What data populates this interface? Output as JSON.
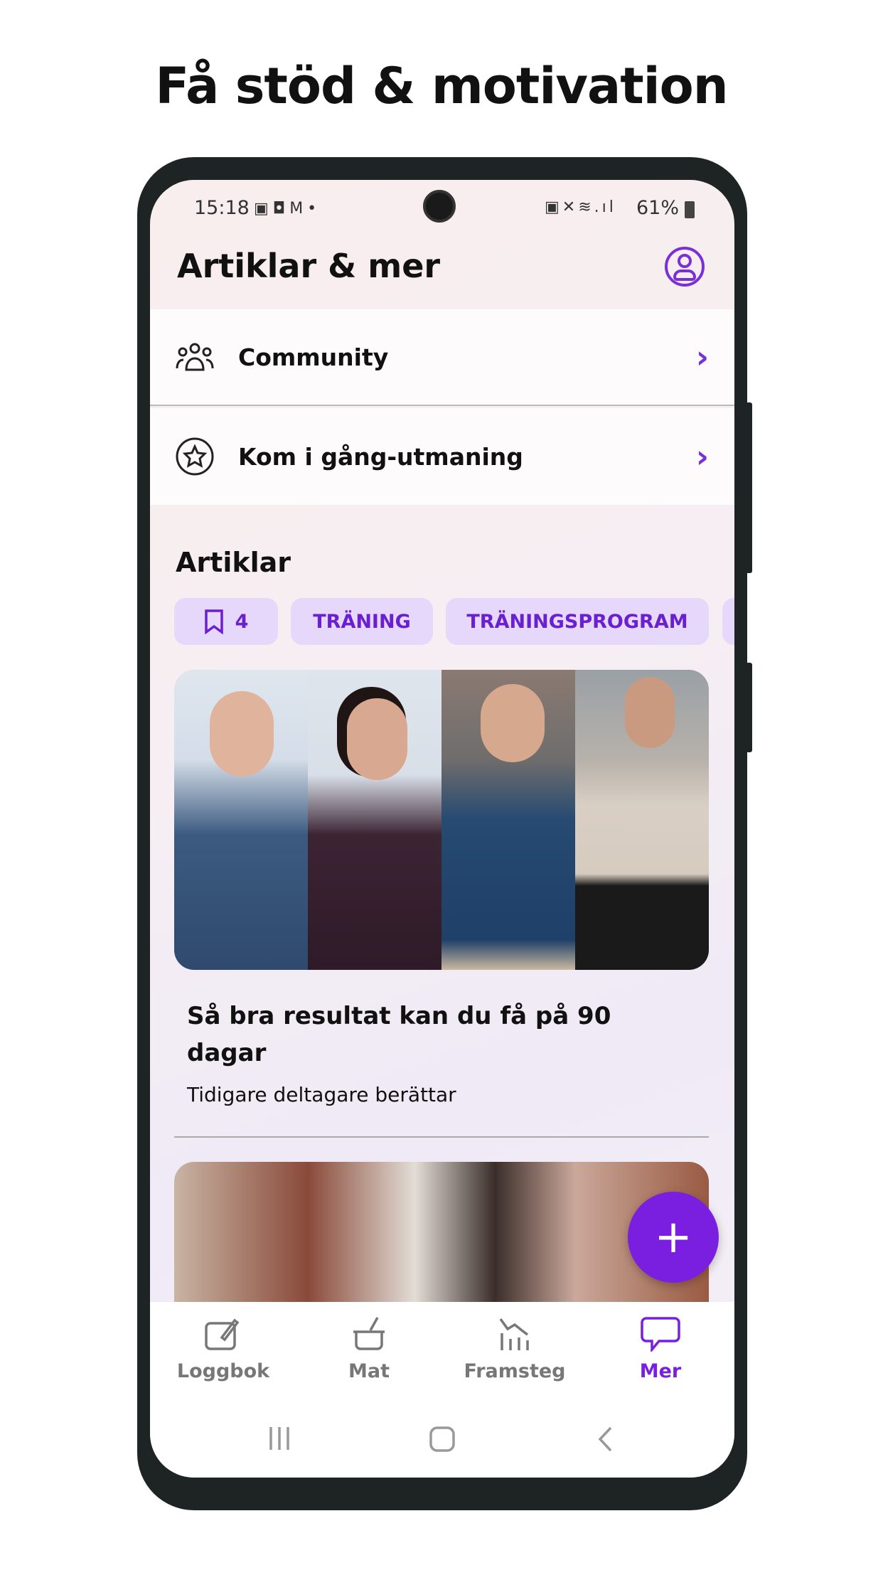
{
  "headline": "Få stöd & motivation",
  "status": {
    "time": "15:18",
    "battery": "61%"
  },
  "header": {
    "title": "Artiklar & mer"
  },
  "menu": [
    {
      "label": "Community",
      "icon": "people-icon"
    },
    {
      "label": "Kom i gång-utmaning",
      "icon": "star-icon"
    }
  ],
  "articles": {
    "heading": "Artiklar",
    "chips": [
      {
        "label": "4",
        "icon": "bookmark-icon"
      },
      {
        "label": "TRÄNING"
      },
      {
        "label": "TRÄNINGSPROGRAM"
      }
    ],
    "items": [
      {
        "title": "Så bra resultat kan du få på 90 dagar",
        "subtitle": "Tidigare deltagare berättar"
      }
    ]
  },
  "fab": {
    "label": "+"
  },
  "nav": [
    {
      "label": "Loggbok",
      "active": false
    },
    {
      "label": "Mat",
      "active": false
    },
    {
      "label": "Framsteg",
      "active": false
    },
    {
      "label": "Mer",
      "active": true
    }
  ],
  "colors": {
    "accent": "#7a1fe0",
    "chip_bg": "#e6d8fb",
    "inactive": "#777777"
  }
}
